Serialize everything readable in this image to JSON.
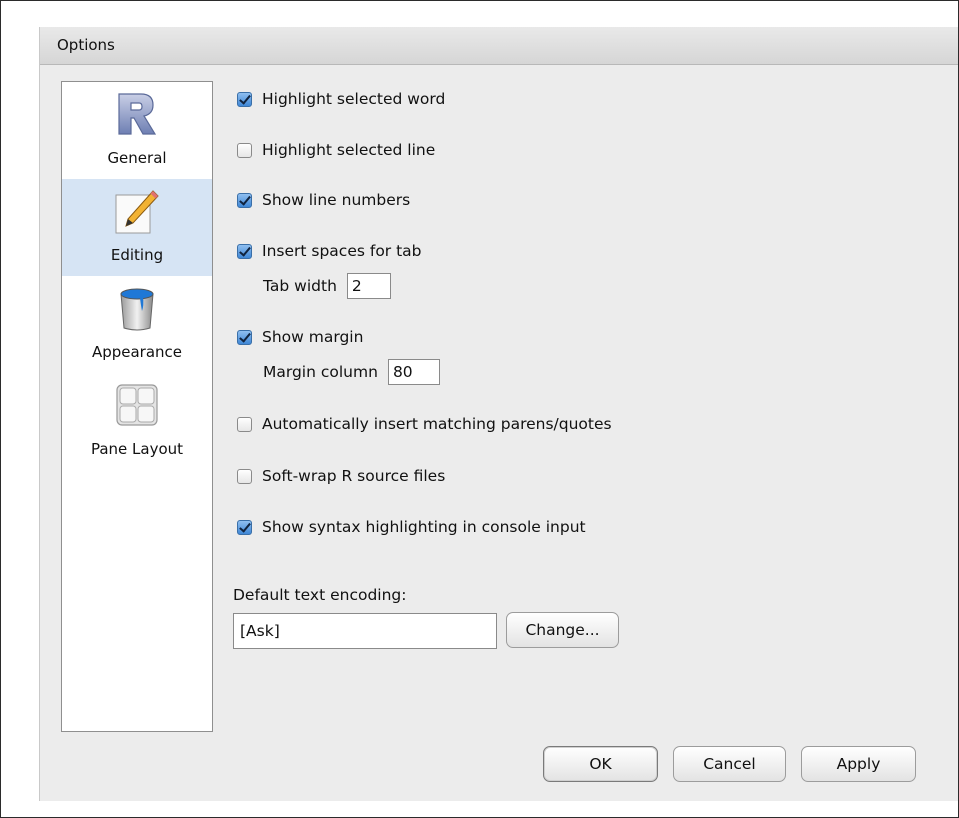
{
  "dialog": {
    "title": "Options"
  },
  "sidebar": {
    "items": [
      {
        "label": "General",
        "icon": "r-logo-icon",
        "selected": false
      },
      {
        "label": "Editing",
        "icon": "pencil-icon",
        "selected": true
      },
      {
        "label": "Appearance",
        "icon": "paint-bucket-icon",
        "selected": false
      },
      {
        "label": "Pane Layout",
        "icon": "pane-grid-icon",
        "selected": false
      }
    ]
  },
  "editing": {
    "highlight_word": {
      "label": "Highlight selected word",
      "checked": true
    },
    "highlight_line": {
      "label": "Highlight selected line",
      "checked": false
    },
    "line_numbers": {
      "label": "Show line numbers",
      "checked": true
    },
    "spaces_for_tab": {
      "label": "Insert spaces for tab",
      "checked": true
    },
    "tab_width": {
      "label": "Tab width",
      "value": "2"
    },
    "show_margin": {
      "label": "Show margin",
      "checked": true
    },
    "margin_column": {
      "label": "Margin column",
      "value": "80"
    },
    "auto_parens": {
      "label": "Automatically insert matching parens/quotes",
      "checked": false
    },
    "soft_wrap": {
      "label": "Soft-wrap R source files",
      "checked": false
    },
    "syntax_console": {
      "label": "Show syntax highlighting in console input",
      "checked": true
    },
    "encoding": {
      "label": "Default text encoding:",
      "value": "[Ask]",
      "change_label": "Change..."
    }
  },
  "footer": {
    "ok_label": "OK",
    "cancel_label": "Cancel",
    "apply_label": "Apply"
  },
  "colors": {
    "selection": "#d6e4f4",
    "checkbox_checked": "#3f87d6",
    "dialog_bg": "#ececec"
  }
}
